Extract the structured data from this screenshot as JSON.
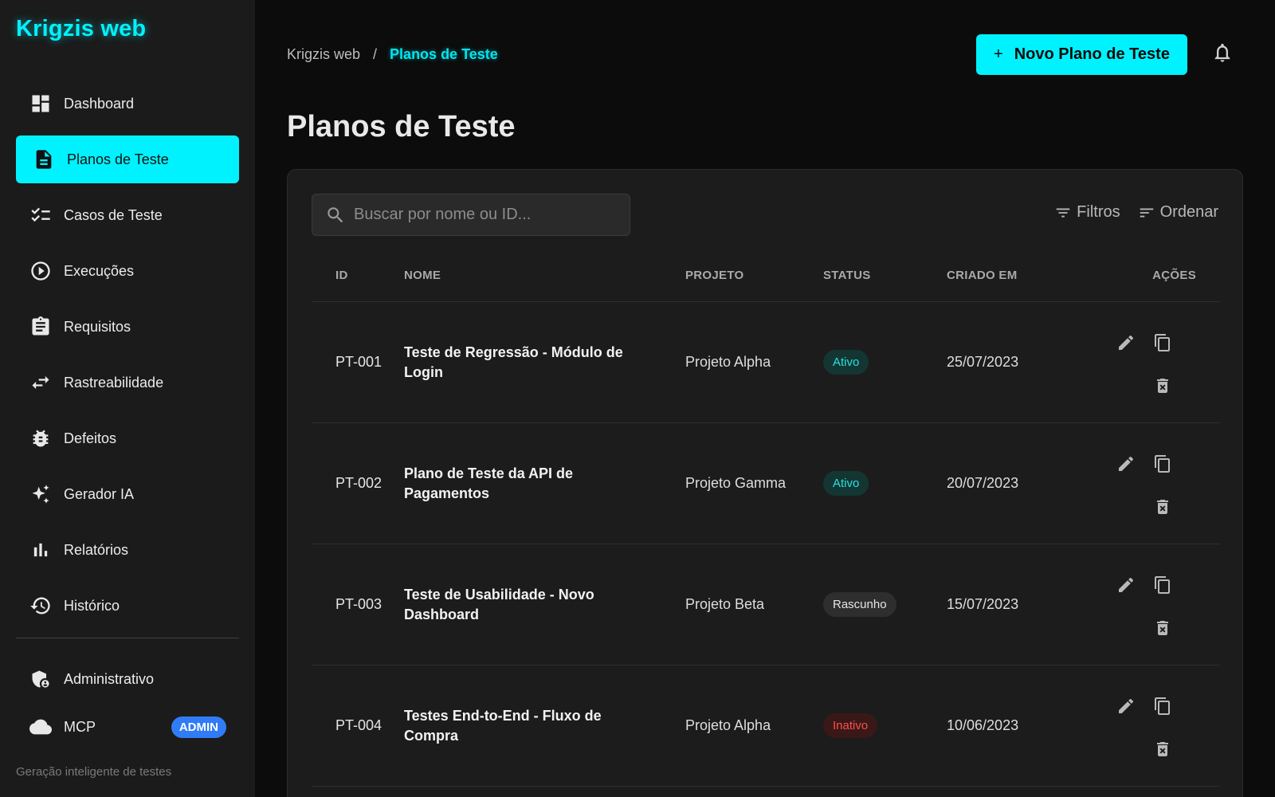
{
  "app": {
    "brand": "Krigzis web",
    "tagline": "Geração inteligente de testes"
  },
  "sidebar": {
    "items": [
      {
        "label": "Dashboard",
        "icon": "dashboard-icon"
      },
      {
        "label": "Planos de Teste",
        "icon": "document-icon",
        "active": true
      },
      {
        "label": "Casos de Teste",
        "icon": "checklist-icon"
      },
      {
        "label": "Execuções",
        "icon": "play-circle-icon"
      },
      {
        "label": "Requisitos",
        "icon": "clipboard-icon"
      },
      {
        "label": "Rastreabilidade",
        "icon": "swap-arrows-icon"
      },
      {
        "label": "Defeitos",
        "icon": "bug-icon"
      },
      {
        "label": "Gerador IA",
        "icon": "sparkles-icon"
      },
      {
        "label": "Relatórios",
        "icon": "bar-chart-icon"
      },
      {
        "label": "Histórico",
        "icon": "history-icon"
      }
    ],
    "bottom": [
      {
        "label": "Administrativo",
        "icon": "admin-shield-icon"
      },
      {
        "label": "MCP",
        "icon": "cloud-icon",
        "badge": "ADMIN"
      }
    ]
  },
  "header": {
    "breadcrumb_root": "Krigzis web",
    "breadcrumb_sep": "/",
    "breadcrumb_current": "Planos de Teste",
    "new_button_plus": "+",
    "new_button_label": "Novo Plano de Teste"
  },
  "page": {
    "title": "Planos de Teste"
  },
  "toolbar": {
    "search_placeholder": "Buscar por nome ou ID...",
    "filters_label": "Filtros",
    "sort_label": "Ordenar"
  },
  "table": {
    "columns": [
      "ID",
      "NOME",
      "PROJETO",
      "STATUS",
      "CRIADO EM",
      "AÇÕES"
    ],
    "rows": [
      {
        "id": "PT-001",
        "name": "Teste de Regressão - Módulo de Login",
        "project": "Projeto Alpha",
        "status": "Ativo",
        "status_kind": "ativo",
        "created": "25/07/2023"
      },
      {
        "id": "PT-002",
        "name": "Plano de Teste da API de Pagamentos",
        "project": "Projeto Gamma",
        "status": "Ativo",
        "status_kind": "ativo",
        "created": "20/07/2023"
      },
      {
        "id": "PT-003",
        "name": "Teste de Usabilidade - Novo Dashboard",
        "project": "Projeto Beta",
        "status": "Rascunho",
        "status_kind": "rascunho",
        "created": "15/07/2023"
      },
      {
        "id": "PT-004",
        "name": "Testes End-to-End - Fluxo de Compra",
        "project": "Projeto Alpha",
        "status": "Inativo",
        "status_kind": "inativo",
        "created": "10/06/2023"
      }
    ]
  },
  "colors": {
    "accent": "#00f2fe",
    "sidebar_bg": "#1b1b1b",
    "main_bg": "#0c0c0c",
    "card_bg": "#1c1c1c",
    "admin_badge": "#2f7cf6",
    "status_ativo": "#27e1df",
    "status_inativo": "#ff4d4d"
  }
}
